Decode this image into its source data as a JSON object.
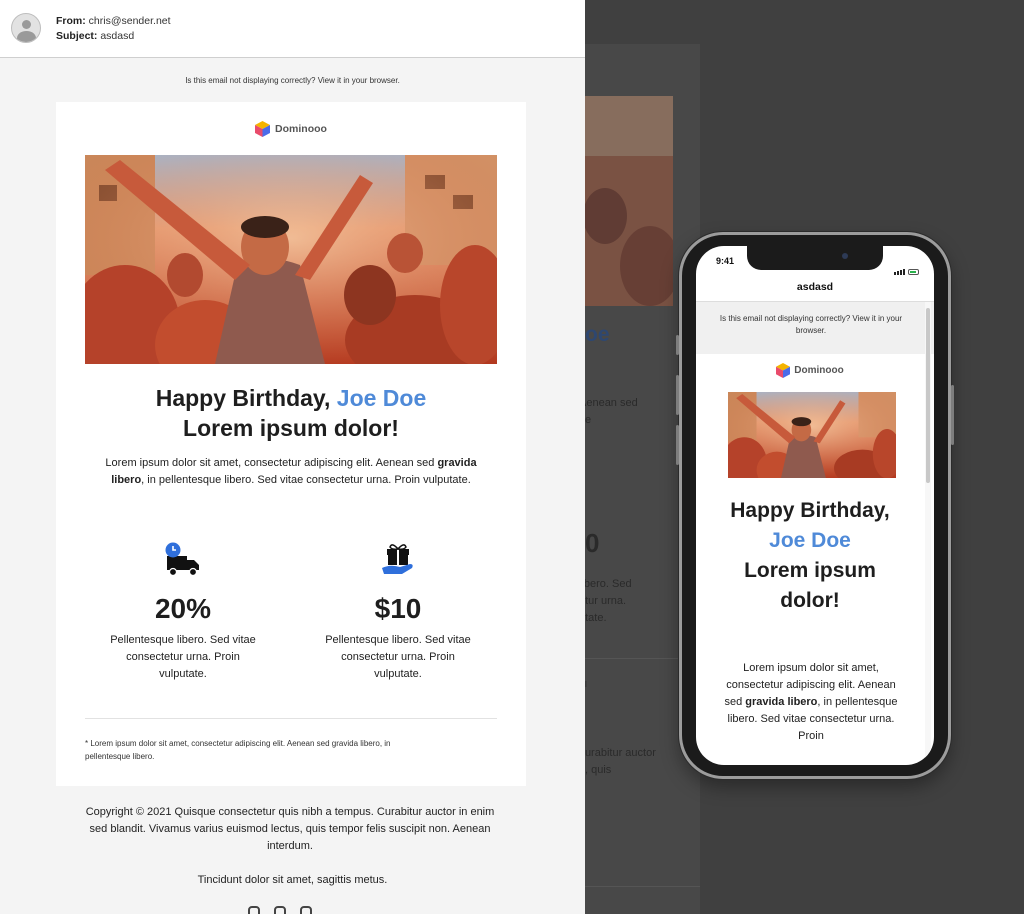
{
  "email": {
    "from_label": "From:",
    "from_value": "chris@sender.net",
    "subject_label": "Subject:",
    "subject_value": "asdasd",
    "not_displaying": "Is this email not displaying correctly? View it in your browser.",
    "brand": "Dominooo",
    "heading_prefix": "Happy Birthday, ",
    "heading_name": "Joe Doe",
    "heading_line2": "Lorem ipsum dolor!",
    "intro_before": "Lorem ipsum dolor sit amet, consectetur adipiscing elit. Aenean sed ",
    "intro_bold": "gravida libero",
    "intro_after": ", in pellentesque libero. Sed vitae consectetur urna. Proin vulputate.",
    "features": [
      {
        "icon": "delivery-truck-clock-icon",
        "value": "20%",
        "text": "Pellentesque libero. Sed vitae consectetur urna. Proin vulputate."
      },
      {
        "icon": "gift-in-hand-icon",
        "value": "$10",
        "text": "Pellentesque libero. Sed vitae consectetur urna. Proin vulputate."
      }
    ],
    "footnote": "* Lorem ipsum dolor sit amet, consectetur adipiscing elit. Aenean sed gravida libero, in pellentesque libero.",
    "copyright": "Copyright © 2021 Quisque consectetur quis nibh a tempus. Curabitur auctor in enim sed blandit. Vivamus varius euismod lectus, quis tempor felis suscipit non. Aenean interdum.",
    "tincidunt": "Tincidunt dolor sit amet, sagittis metus."
  },
  "phone": {
    "time": "9:41",
    "title": "asdasd",
    "not_displaying": "Is this email not displaying correctly? View it in your browser.",
    "brand": "Dominooo",
    "heading_prefix": "Happy Birthday, ",
    "heading_name": "Joe Doe",
    "heading_line2": "Lorem ipsum dolor!",
    "intro_before": "Lorem ipsum dolor sit amet, consectetur adipiscing elit. Aenean sed ",
    "intro_bold": "gravida libero",
    "intro_after": ", in pellentesque libero. Sed vitae consectetur urna. Proin"
  },
  "ghost": {
    "fragments": [
      "oe",
      "Aenean sed",
      "e",
      "0",
      "libero. Sed",
      "etur urna.",
      "utate.",
      "l",
      "Curabitur auctor",
      ", quis"
    ]
  },
  "colors": {
    "accent": "#4f8ad8",
    "background_dark": "#3b3b3b"
  }
}
